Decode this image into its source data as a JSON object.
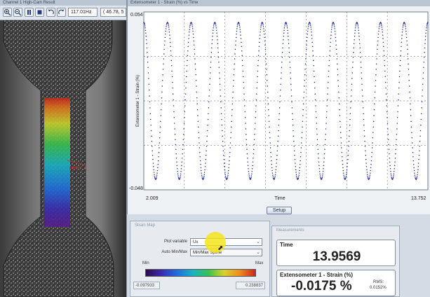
{
  "camera_pane": {
    "title": "Channel 1 High-Cam Result",
    "toolbar": {
      "zoom_in_icon": "magnifier-plus",
      "zoom_out_icon": "magnifier-minus",
      "pause_icon": "pause",
      "stop_icon": "stop",
      "undo_icon": "undo-arrow",
      "redo_icon": "redo-arrow",
      "rate": "117.01Hz",
      "coords": "( 46.78, 5"
    },
    "overlay_label": "neter 1"
  },
  "plot_pane": {
    "title": "Extensometer 1 - Strain (%) vs Time",
    "y_top_label": "0.054",
    "y_bottom_label": "-0.048",
    "x_left_label": "2.009",
    "x_right_label": "13.752",
    "setup_button": "Setup"
  },
  "chart_data": {
    "type": "scatter",
    "title": "",
    "xlabel": "Time",
    "ylabel": "Extensometer 1 - Strain (%)",
    "xlim": [
      2.009,
      13.752
    ],
    "ylim": [
      -0.048,
      0.054
    ],
    "x_tick_labels": [
      "2.009",
      "13.752"
    ],
    "y_tick_labels": [
      "0.054",
      "-0.048"
    ],
    "grid": true,
    "series": [
      {
        "name": "",
        "color": "#1a2a8c",
        "waveform": "sine",
        "cycles": 12,
        "amplitude": 0.045,
        "offset": 0.003,
        "phase_start": "peak"
      }
    ]
  },
  "strain_map_panel": {
    "title": "Strain Map",
    "plot_variable_label": "Plot variable",
    "plot_variable_value": "Ux",
    "auto_label": "Auto Min/Max",
    "auto_value": "Min/Max Spline",
    "min_label": "Min",
    "max_label": "Max",
    "min_value": "-0.097933",
    "max_value": "0.238837",
    "colorbar_colors": [
      "#2b0a4a",
      "#3a2bb0",
      "#1f6fe0",
      "#17b3c4",
      "#37c24f",
      "#d7d32a",
      "#f08b1d",
      "#c8281b"
    ]
  },
  "measurements_panel": {
    "title": "Measurements",
    "time_label": "Time",
    "time_value": "13.9569",
    "strain_label": "Extensometer 1 - Strain (%)",
    "strain_value": "-0.0175 %",
    "rms_label": "RMS:",
    "rms_value": "0.0152%"
  }
}
